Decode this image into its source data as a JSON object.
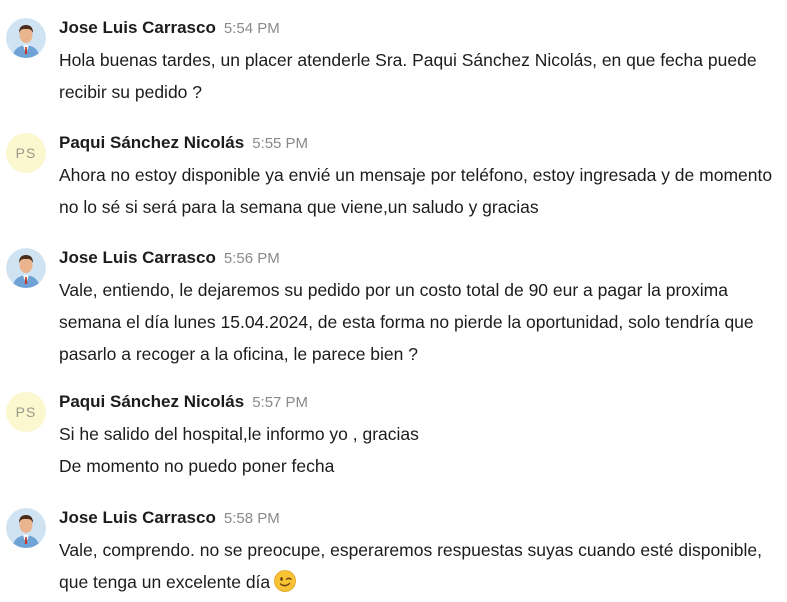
{
  "messages": [
    {
      "author": "Jose Luis Carrasco",
      "time": "5:54 PM",
      "lines": [
        "Hola buenas tardes, un placer atenderle Sra. Paqui Sánchez Nicolás, en que fecha puede recibir su pedido ?"
      ]
    },
    {
      "author": "Paqui Sánchez Nicolás",
      "initials": "PS",
      "time": "5:55 PM",
      "lines": [
        "Ahora no estoy disponible ya envié un mensaje por teléfono, estoy ingresada y de momento no lo sé si será para la semana que viene,un saludo y gracias"
      ]
    },
    {
      "author": "Jose Luis Carrasco",
      "time": "5:56 PM",
      "lines": [
        "Vale, entiendo, le dejaremos su pedido por un costo total de 90 eur a pagar la proxima semana el día lunes 15.04.2024, de esta forma no pierde la oportunidad, solo tendría que pasarlo a recoger a la oficina, le parece bien ?"
      ]
    },
    {
      "author": "Paqui Sánchez Nicolás",
      "initials": "PS",
      "time": "5:57 PM",
      "lines": [
        "Si he salido del hospital,le informo yo , gracias",
        "De momento no puedo poner fecha"
      ]
    },
    {
      "author": "Jose Luis Carrasco",
      "time": "5:58 PM",
      "lines": [
        "Vale, comprendo. no se preocupe, esperaremos respuestas suyas cuando esté disponible, que tenga un excelente día"
      ],
      "emoji": "winking-face-emoji"
    }
  ]
}
